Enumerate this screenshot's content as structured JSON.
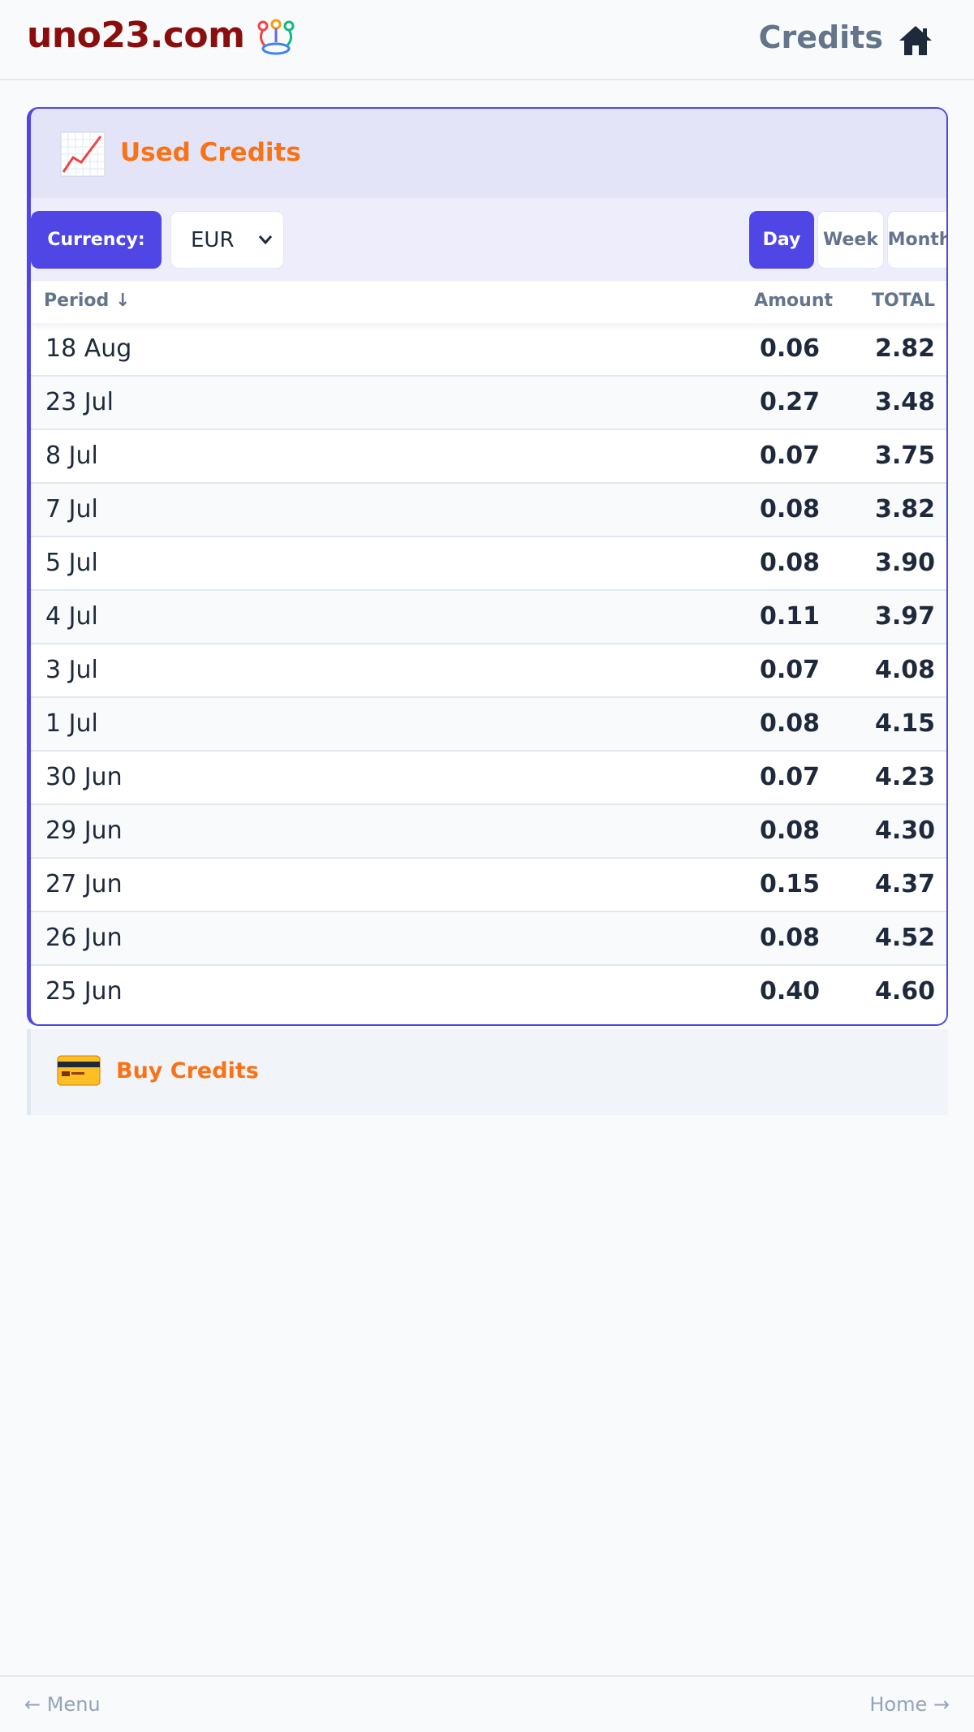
{
  "header": {
    "site_name": "uno23.com",
    "page_title": "Credits"
  },
  "used_credits": {
    "title": "Used Credits",
    "currency_label": "Currency:",
    "currency_value": "EUR",
    "period_buttons": [
      "Day",
      "Week",
      "Month"
    ],
    "selected_period": "Day",
    "columns": {
      "period": "Period ↓",
      "amount": "Amount",
      "total": "TOTAL"
    },
    "rows": [
      {
        "period": "18 Aug",
        "amount": "0.06",
        "total": "2.82"
      },
      {
        "period": "23 Jul",
        "amount": "0.27",
        "total": "3.48"
      },
      {
        "period": "8 Jul",
        "amount": "0.07",
        "total": "3.75"
      },
      {
        "period": "7 Jul",
        "amount": "0.08",
        "total": "3.82"
      },
      {
        "period": "5 Jul",
        "amount": "0.08",
        "total": "3.90"
      },
      {
        "period": "4 Jul",
        "amount": "0.11",
        "total": "3.97"
      },
      {
        "period": "3 Jul",
        "amount": "0.07",
        "total": "4.08"
      },
      {
        "period": "1 Jul",
        "amount": "0.08",
        "total": "4.15"
      },
      {
        "period": "30 Jun",
        "amount": "0.07",
        "total": "4.23"
      },
      {
        "period": "29 Jun",
        "amount": "0.08",
        "total": "4.30"
      },
      {
        "period": "27 Jun",
        "amount": "0.15",
        "total": "4.37"
      },
      {
        "period": "26 Jun",
        "amount": "0.08",
        "total": "4.52"
      },
      {
        "period": "25 Jun",
        "amount": "0.40",
        "total": "4.60"
      }
    ]
  },
  "buy_credits": {
    "label": "Buy Credits"
  },
  "footer": {
    "menu_label": "← Menu",
    "home_label": "Home →"
  },
  "colors": {
    "brand": "#8b0e0e",
    "accent": "#4f46e5",
    "highlight": "#f97316"
  },
  "icons": {
    "logo": "people-ring-icon",
    "home": "home-icon",
    "used_credits": "chart-increasing-icon",
    "buy_credits": "credit-card-icon"
  }
}
